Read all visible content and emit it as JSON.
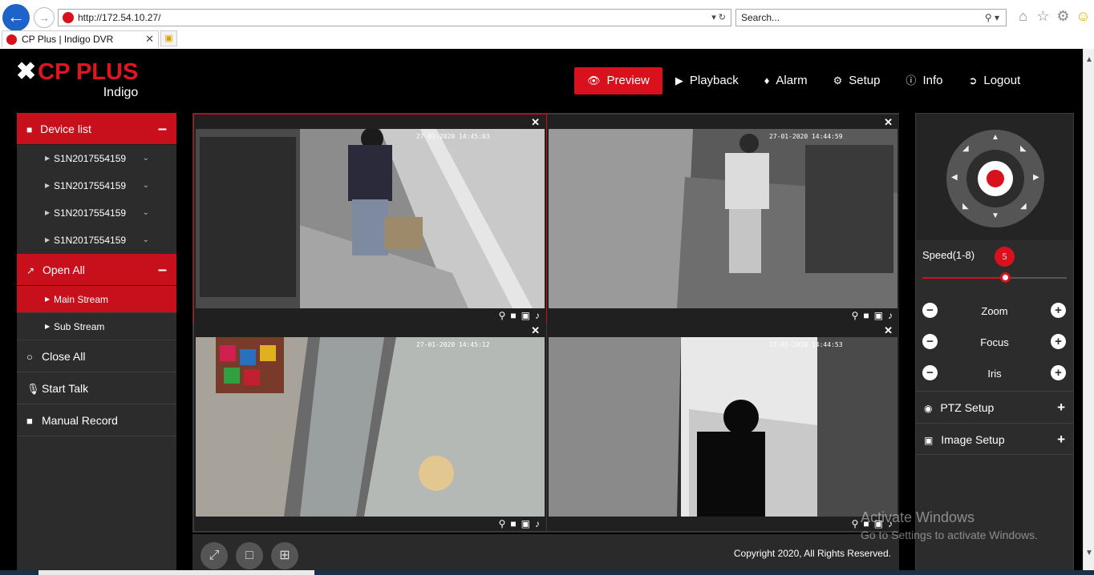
{
  "browser": {
    "url": "http://172.54.10.27/",
    "search_placeholder": "Search...",
    "tab_title": "CP Plus | Indigo DVR"
  },
  "logo": {
    "brand": "CP PLUS",
    "sub": "Indigo"
  },
  "topnav": [
    {
      "label": "Preview",
      "icon": "eye-icon",
      "active": true
    },
    {
      "label": "Playback",
      "icon": "play-circle-icon"
    },
    {
      "label": "Alarm",
      "icon": "bell-icon"
    },
    {
      "label": "Setup",
      "icon": "gear-icon"
    },
    {
      "label": "Info",
      "icon": "info-icon"
    },
    {
      "label": "Logout",
      "icon": "logout-icon"
    }
  ],
  "sidebar": {
    "device_list": "Device list",
    "devices": [
      "S1N2017554159",
      "S1N2017554159",
      "S1N2017554159",
      "S1N2017554159"
    ],
    "open_all": "Open All",
    "streams": [
      {
        "label": "Main Stream",
        "active": true
      },
      {
        "label": "Sub Stream",
        "active": false
      }
    ],
    "close_all": "Close All",
    "start_talk": "Start Talk",
    "manual_record": "Manual Record"
  },
  "cameras": [
    {
      "timestamp": "27-01-2020 14:45:03",
      "selected": true
    },
    {
      "timestamp": "27-01-2020 14:44:59",
      "selected": false
    },
    {
      "timestamp": "27-01-2020 14:45:12",
      "selected": false
    },
    {
      "timestamp": "27-01-2020 14:44:53",
      "selected": false
    }
  ],
  "footer": {
    "copyright": "Copyright 2020, All Rights Reserved."
  },
  "ptz": {
    "speed_label": "Speed(1-8)",
    "speed_value": "5",
    "speed_fraction": 0.57,
    "zoom": "Zoom",
    "focus": "Focus",
    "iris": "Iris",
    "ptz_setup": "PTZ Setup",
    "image_setup": "Image Setup"
  },
  "watermark": {
    "line1": "Activate Windows",
    "line2": "Go to Settings to activate Windows."
  },
  "colors": {
    "accent": "#d8111c",
    "panel": "#2c2c2c",
    "background": "#000000"
  }
}
